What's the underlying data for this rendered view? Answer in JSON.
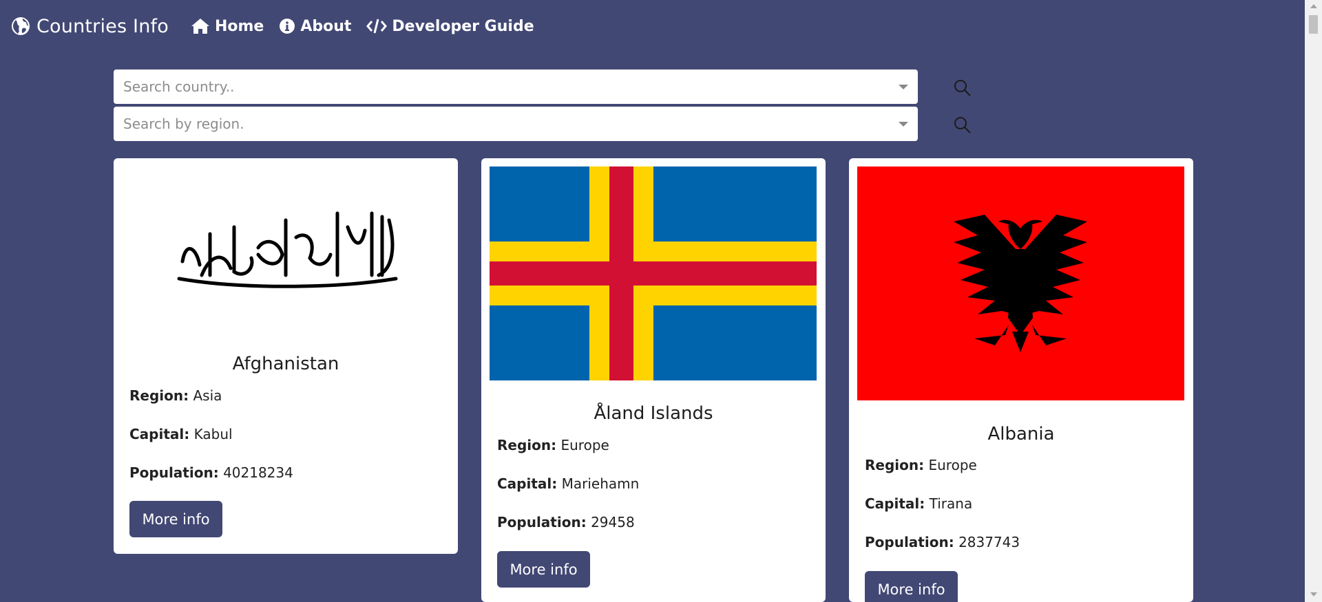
{
  "navbar": {
    "brand": "Countries Info",
    "links": [
      {
        "label": "Home",
        "icon": "home-icon"
      },
      {
        "label": "About",
        "icon": "info-icon"
      },
      {
        "label": "Developer Guide",
        "icon": "code-icon"
      }
    ]
  },
  "search": {
    "country_placeholder": "Search country..",
    "region_placeholder": "Search by region."
  },
  "labels": {
    "region": "Region:",
    "capital": "Capital:",
    "population": "Population:",
    "more_info": "More info"
  },
  "countries": [
    {
      "name": "Afghanistan",
      "region": "Asia",
      "capital": "Kabul",
      "population": "40218234",
      "flag": "afghanistan-flag-icon"
    },
    {
      "name": "Åland Islands",
      "region": "Europe",
      "capital": "Mariehamn",
      "population": "29458",
      "flag": "aland-flag-icon"
    },
    {
      "name": "Albania",
      "region": "Europe",
      "capital": "Tirana",
      "population": "2837743",
      "flag": "albania-flag-icon"
    }
  ],
  "colors": {
    "background": "#424874",
    "button": "#424874",
    "card": "#ffffff"
  }
}
